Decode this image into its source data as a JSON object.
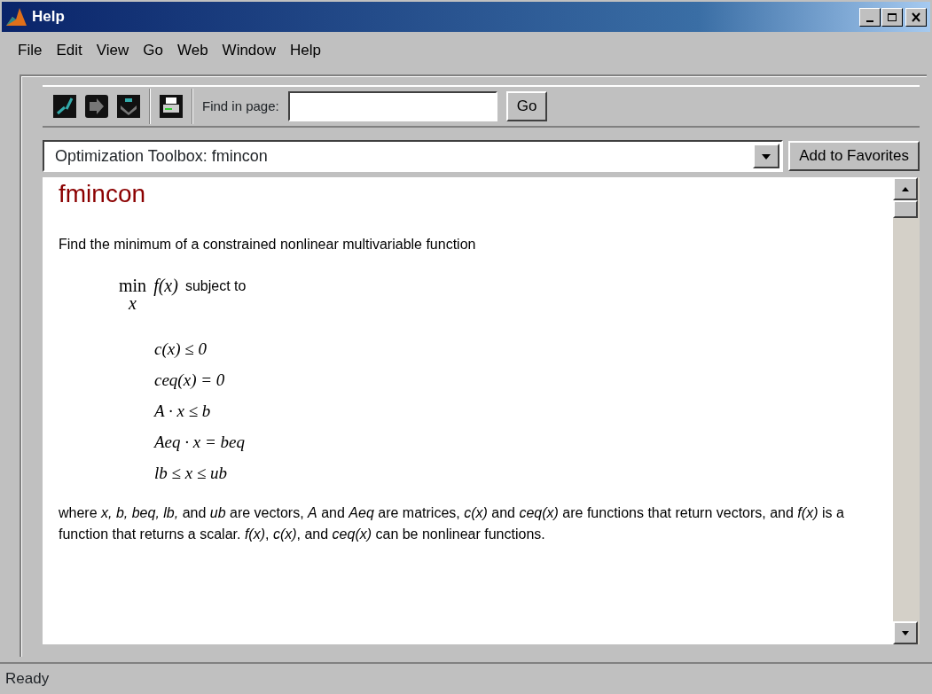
{
  "window": {
    "title": "Help"
  },
  "menu": [
    "File",
    "Edit",
    "View",
    "Go",
    "Web",
    "Window",
    "Help"
  ],
  "toolbar": {
    "find_label": "Find in page:",
    "go_button": "Go"
  },
  "location": {
    "value": "Optimization Toolbox: fmincon",
    "favorites_button": "Add to Favorites"
  },
  "page": {
    "heading": "fmincon",
    "summary": "Find the minimum of a constrained nonlinear multivariable function",
    "objective": {
      "operator": "min",
      "subscript": "x",
      "expression": "f(x)",
      "text": "subject to"
    },
    "constraints": [
      "c(x) ≤ 0",
      "ceq(x)  =  0",
      "A · x ≤ b",
      "Aeq · x  =  beq",
      "lb ≤ x ≤ ub"
    ],
    "description": "where *x, b, beq, lb,* and *ub* are vectors, *A* and *Aeq* are matrices, *c(x)* and *ceq(x)* are functions that return vectors, and *f(x)* is a function that returns a scalar. *f(x)*, *c(x)*, and *ceq(x)* can be nonlinear functions."
  },
  "status_bar": "Ready"
}
